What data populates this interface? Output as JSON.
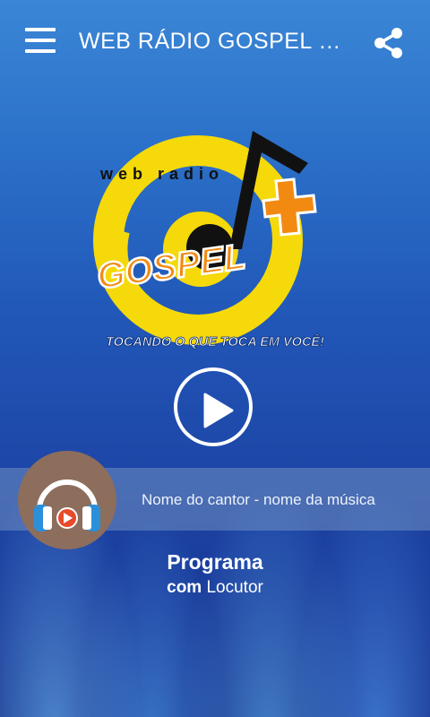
{
  "app": {
    "title": "WEB RÁDIO GOSPEL MAIS",
    "menu_icon": "hamburger-menu-icon",
    "share_icon": "share-icon"
  },
  "logo": {
    "line1": "web radio",
    "line2": "GOSPEL",
    "plus": "+",
    "slogan": "TOCANDO O QUE TOCA EM VOCÊ!",
    "colors": {
      "yellow": "#f5d90a",
      "orange": "#f28a12",
      "black": "#111111"
    }
  },
  "player": {
    "play_icon": "play-icon",
    "now_playing": "Nome do cantor - nome da música",
    "avatar_icon": "headphones-icon"
  },
  "program": {
    "name": "Programa",
    "host_prefix": "com",
    "host_name": "Locutor"
  }
}
